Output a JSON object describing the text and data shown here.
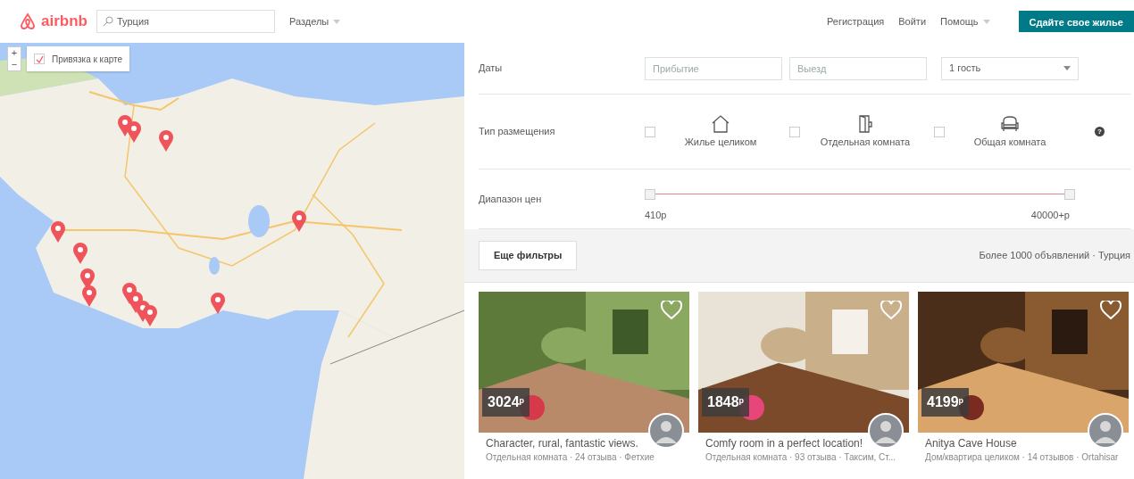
{
  "header": {
    "logo": "airbnb",
    "search": {
      "value": "Турция"
    },
    "sections_menu": "Разделы",
    "links": [
      "Регистрация",
      "Войти"
    ],
    "help_menu": "Помощь",
    "host_button": "Сдайте свое жилье"
  },
  "map": {
    "snap_checkbox": {
      "label": "Привязка к карте",
      "checked": true
    },
    "zoom_in": "+",
    "zoom_out": "−"
  },
  "filters": {
    "dates": {
      "label": "Даты",
      "checkin_placeholder": "Прибытие",
      "checkout_placeholder": "Выезд",
      "guests": "1 гость"
    },
    "room_type": {
      "label": "Тип размещения",
      "options": [
        {
          "label": "Жилье целиком",
          "kind": "house",
          "checked": false
        },
        {
          "label": "Отдельная комната",
          "kind": "door",
          "checked": false
        },
        {
          "label": "Общая комната",
          "kind": "sofa",
          "checked": false
        }
      ],
      "help": "?"
    },
    "price": {
      "label": "Диапазон цен",
      "min_thumb": {
        "level": 0
      },
      "max_thumb": {
        "level": 1
      },
      "min_label": "410р",
      "max_label": "40000+р"
    },
    "more_button": "Еще фильтры",
    "results": "Более 1000 объявлений · Турция"
  },
  "listings": [
    {
      "price": "3024$^{р}$",
      "title": "Character, rural, fantastic views.",
      "subtitle": "Отдельная комната · 24 отзыва · Фетхие",
      "saved": false
    },
    {
      "price": "1848$^{р}$",
      "title": "Comfy room in a perfect location!",
      "subtitle": "Отдельная комната · 93 отзыва · Таксим, Ст...",
      "saved": false
    },
    {
      "price": "4199$^{р}$",
      "title": "Anitya Cave House",
      "subtitle": "Дом/квартира целиком · 14 отзывов · Ortahisar",
      "saved": false
    }
  ]
}
